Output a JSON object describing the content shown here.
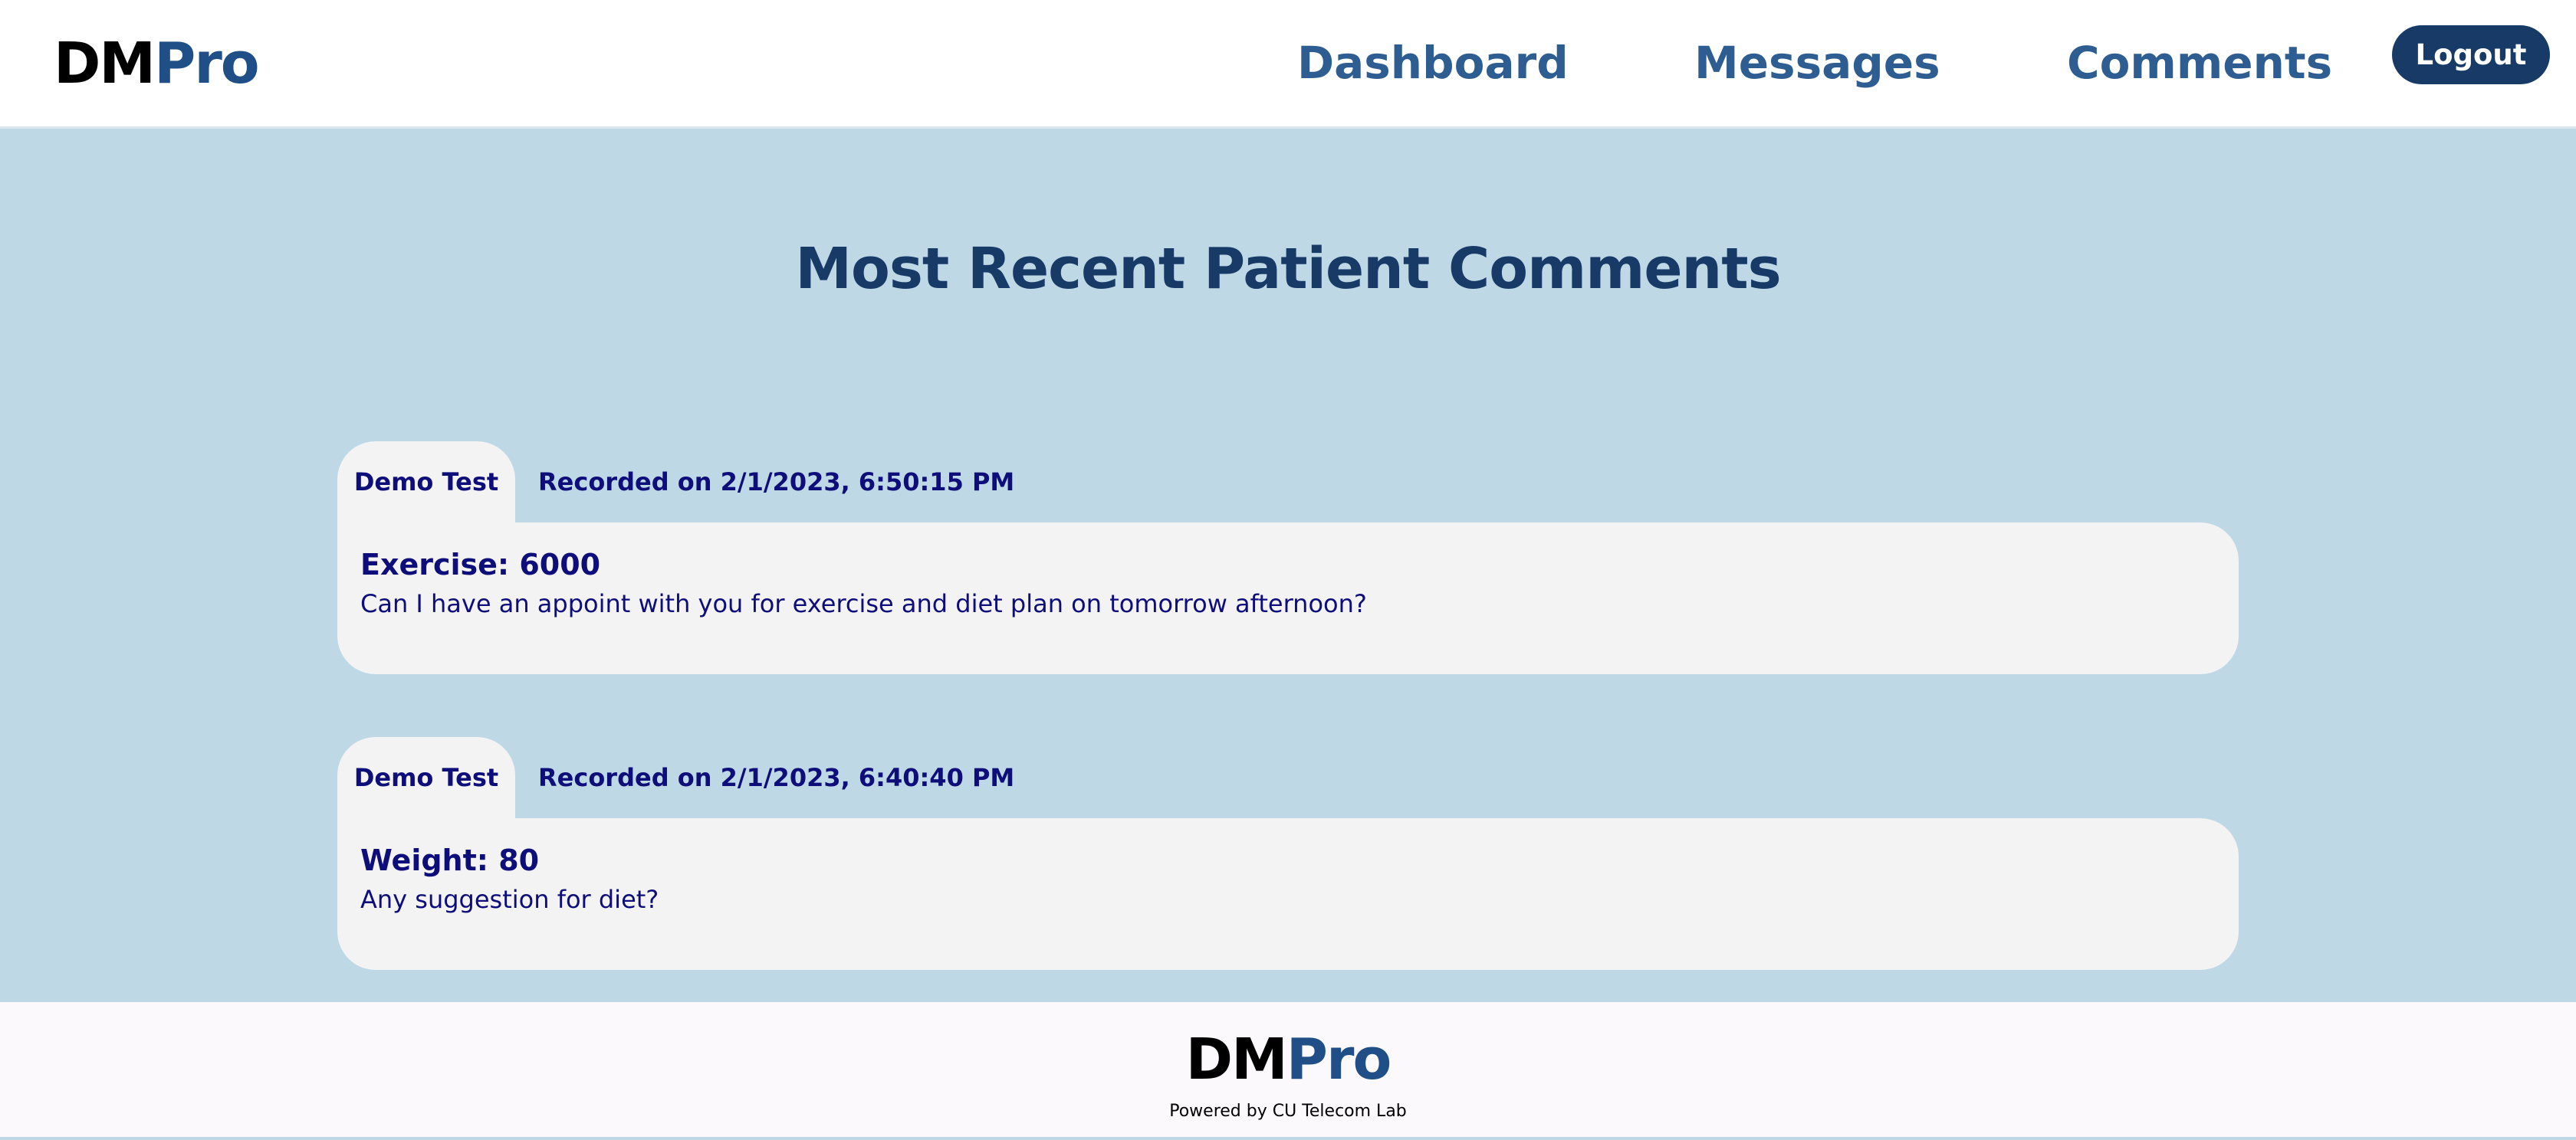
{
  "header": {
    "logo_dm": "DM",
    "logo_pro": "Pro",
    "nav": [
      {
        "label": "Dashboard"
      },
      {
        "label": "Messages"
      },
      {
        "label": "Comments"
      }
    ],
    "logout_label": "Logout"
  },
  "main": {
    "title": "Most Recent Patient Comments",
    "comments": [
      {
        "author": "Demo Test",
        "recorded": "Recorded on 2/1/2023, 6:50:15 PM",
        "metric": "Exercise: 6000",
        "text": "Can I have an appoint with you for exercise and diet plan on tomorrow afternoon?"
      },
      {
        "author": "Demo Test",
        "recorded": "Recorded on 2/1/2023, 6:40:40 PM",
        "metric": "Weight: 80",
        "text": "Any suggestion for diet?"
      }
    ]
  },
  "footer": {
    "logo_dm": "DM",
    "logo_pro": "Pro",
    "powered_by": "Powered by CU Telecom Lab"
  },
  "colors": {
    "brand_dark": "#173a67",
    "nav_blue": "#2d5d91",
    "main_bg": "#bfd8e6",
    "card_bg": "#f3f3f3",
    "card_text": "#0e0e7a"
  }
}
